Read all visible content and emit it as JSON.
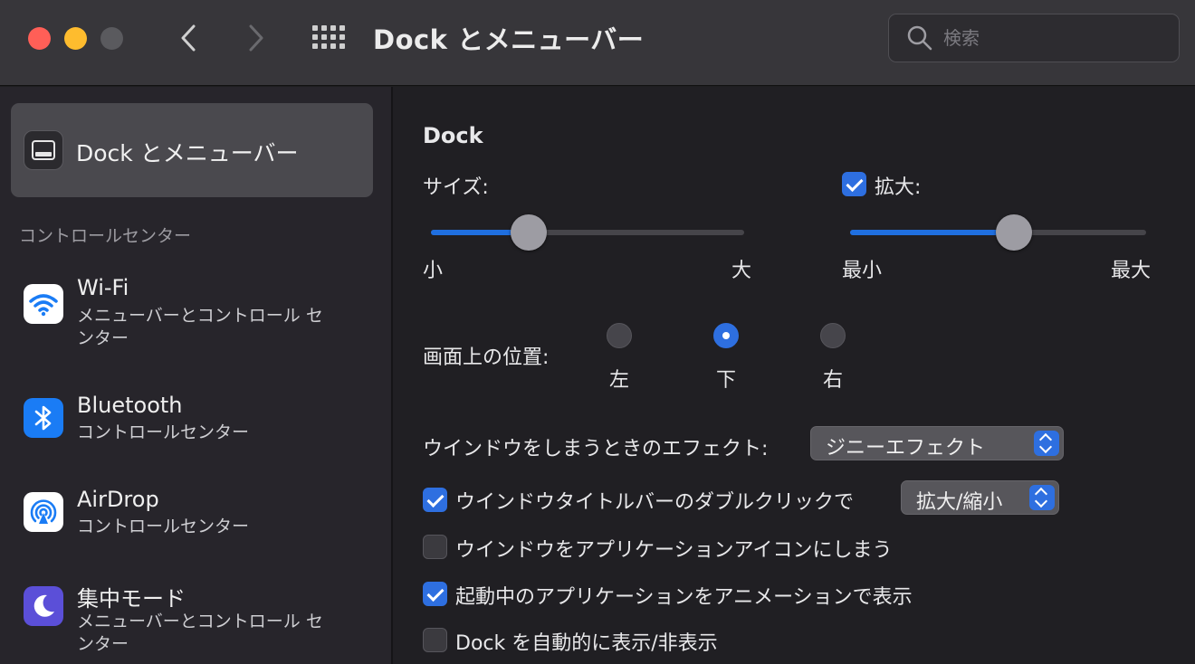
{
  "window": {
    "title": "Dock とメニューバー",
    "search_placeholder": "検索"
  },
  "sidebar": {
    "selected": {
      "label": "Dock とメニューバー",
      "icon": "dock-icon"
    },
    "section_label": "コントロールセンター",
    "items": [
      {
        "name": "Wi-Fi",
        "sub": "メニューバーとコントロール センター",
        "icon": "wifi-icon",
        "color": "#ffffff"
      },
      {
        "name": "Bluetooth",
        "sub": "コントロールセンター",
        "icon": "bluetooth-icon",
        "color": "#1a7cf5"
      },
      {
        "name": "AirDrop",
        "sub": "コントロールセンター",
        "icon": "airdrop-icon",
        "color": "#ffffff"
      },
      {
        "name": "集中モード",
        "sub": "メニューバーとコントロール センター",
        "icon": "moon-icon",
        "color": "#5b4fd8"
      }
    ]
  },
  "main": {
    "section_title": "Dock",
    "size": {
      "label": "サイズ:",
      "min_label": "小",
      "max_label": "大",
      "value_percent": 31
    },
    "magnification": {
      "label": "拡大:",
      "checked": true,
      "min_label": "最小",
      "max_label": "最大",
      "value_percent": 55
    },
    "position": {
      "label": "画面上の位置:",
      "options": [
        {
          "label": "左",
          "selected": false
        },
        {
          "label": "下",
          "selected": true
        },
        {
          "label": "右",
          "selected": false
        }
      ]
    },
    "minimize_effect": {
      "label": "ウインドウをしまうときのエフェクト:",
      "value": "ジニーエフェクト"
    },
    "double_click": {
      "label": "ウインドウタイトルバーのダブルクリックで",
      "checked": true,
      "value": "拡大/縮小"
    },
    "minimize_into_app": {
      "label": "ウインドウをアプリケーションアイコンにしまう",
      "checked": false
    },
    "animate_opening": {
      "label": "起動中のアプリケーションをアニメーションで表示",
      "checked": true
    },
    "autohide": {
      "label": "Dock を自動的に表示/非表示",
      "checked": false
    }
  },
  "colors": {
    "accent": "#2e6fe0",
    "close": "#ff5f57",
    "minimize": "#febc2e"
  }
}
